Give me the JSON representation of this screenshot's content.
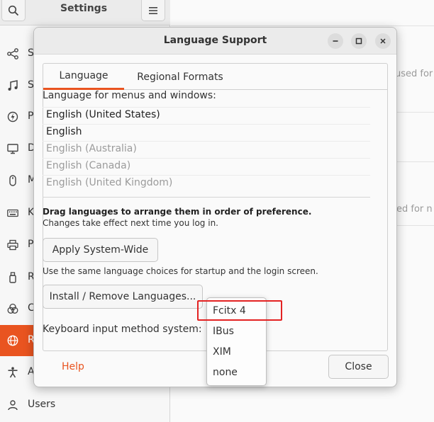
{
  "settings": {
    "title": "Settings",
    "sidebar": [
      {
        "label": "S",
        "icon": "share-icon"
      },
      {
        "label": "S",
        "icon": "music-note-icon"
      },
      {
        "label": "P",
        "icon": "power-icon"
      },
      {
        "label": "D",
        "icon": "display-icon"
      },
      {
        "label": "M",
        "icon": "mouse-icon"
      },
      {
        "label": "K",
        "icon": "keyboard-icon"
      },
      {
        "label": "P",
        "icon": "printer-icon"
      },
      {
        "label": "R",
        "icon": "usb-drive-icon"
      },
      {
        "label": "C",
        "icon": "color-icon"
      },
      {
        "label": "R",
        "icon": "globe-icon",
        "active": true
      },
      {
        "label": "A",
        "icon": "accessibility-icon"
      },
      {
        "label": "Users",
        "icon": "users-icon"
      }
    ],
    "background_fragments": [
      "used for",
      "ed for n"
    ]
  },
  "dialog": {
    "title": "Language Support",
    "tabs": [
      "Language",
      "Regional Formats"
    ],
    "language_heading": "Language for menus and windows:",
    "languages": [
      {
        "name": "English (United States)",
        "enabled": true
      },
      {
        "name": "English",
        "enabled": true
      },
      {
        "name": "English (Australia)",
        "enabled": false
      },
      {
        "name": "English (Canada)",
        "enabled": false
      },
      {
        "name": "English (United Kingdom)",
        "enabled": false
      }
    ],
    "drag_hint": "Drag languages to arrange them in order of preference.",
    "changes_note": "Changes take effect next time you log in.",
    "apply_button": "Apply System-Wide",
    "same_choices_note": "Use the same language choices for startup and the login screen.",
    "install_button": "Install / Remove Languages...",
    "input_method_label": "Keyboard input method system:",
    "input_method_options": [
      "Fcitx 4",
      "IBus",
      "XIM",
      "none"
    ],
    "help": "Help",
    "close_button": "Close"
  },
  "colors": {
    "accent": "#e95420",
    "highlight": "#e32222"
  }
}
